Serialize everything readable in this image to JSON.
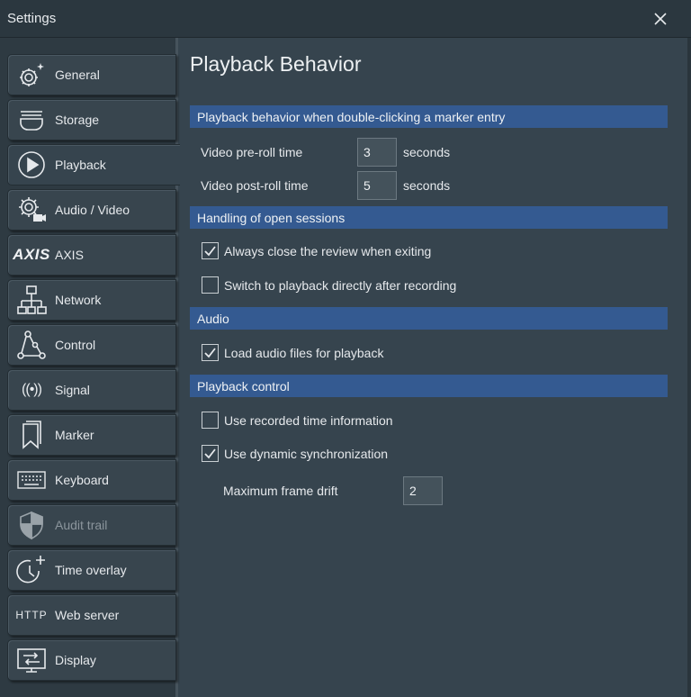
{
  "window": {
    "title": "Settings"
  },
  "sidebar": {
    "items": [
      {
        "label": "General",
        "icon": "gear-sparkle-icon"
      },
      {
        "label": "Storage",
        "icon": "storage-tray-icon"
      },
      {
        "label": "Playback",
        "icon": "play-circle-icon",
        "active": true
      },
      {
        "label": "Audio / Video",
        "icon": "gear-camera-icon"
      },
      {
        "label": "AXIS",
        "icon": "axis-logo-icon",
        "logo_text": "AXIS"
      },
      {
        "label": "Network",
        "icon": "network-tree-icon"
      },
      {
        "label": "Control",
        "icon": "control-nodes-icon"
      },
      {
        "label": "Signal",
        "icon": "signal-broadcast-icon",
        "glyph": "((•))"
      },
      {
        "label": "Marker",
        "icon": "bookmark-icon"
      },
      {
        "label": "Keyboard",
        "icon": "keyboard-icon"
      },
      {
        "label": "Audit trail",
        "icon": "shield-icon",
        "disabled": true
      },
      {
        "label": "Time overlay",
        "icon": "clock-plus-icon"
      },
      {
        "label": "Web server",
        "icon": "http-logo-icon",
        "logo_text": "HTTP"
      },
      {
        "label": "Display",
        "icon": "display-icon"
      }
    ]
  },
  "main": {
    "title": "Playback Behavior",
    "sections": {
      "marker": {
        "header": "Playback behavior when double-clicking a marker entry",
        "preroll": {
          "label": "Video pre-roll time",
          "value": "3",
          "unit": "seconds"
        },
        "postroll": {
          "label": "Video post-roll time",
          "value": "5",
          "unit": "seconds"
        }
      },
      "sessions": {
        "header": "Handling of open sessions",
        "close_review": {
          "label": "Always close the review when exiting",
          "checked": true
        },
        "switch_playback": {
          "label": "Switch to playback directly after recording",
          "checked": false
        }
      },
      "audio": {
        "header": "Audio",
        "load_audio": {
          "label": "Load audio files for playback",
          "checked": true
        }
      },
      "control": {
        "header": "Playback control",
        "recorded_time": {
          "label": "Use recorded time information",
          "checked": false
        },
        "dynamic_sync": {
          "label": "Use dynamic synchronization",
          "checked": true
        },
        "max_drift": {
          "label": "Maximum frame drift",
          "value": "2"
        }
      }
    }
  },
  "colors": {
    "background": "#36444e",
    "sidebar": "#2e3a42",
    "section_header": "#345a91",
    "titlebar": "#2b373f"
  }
}
